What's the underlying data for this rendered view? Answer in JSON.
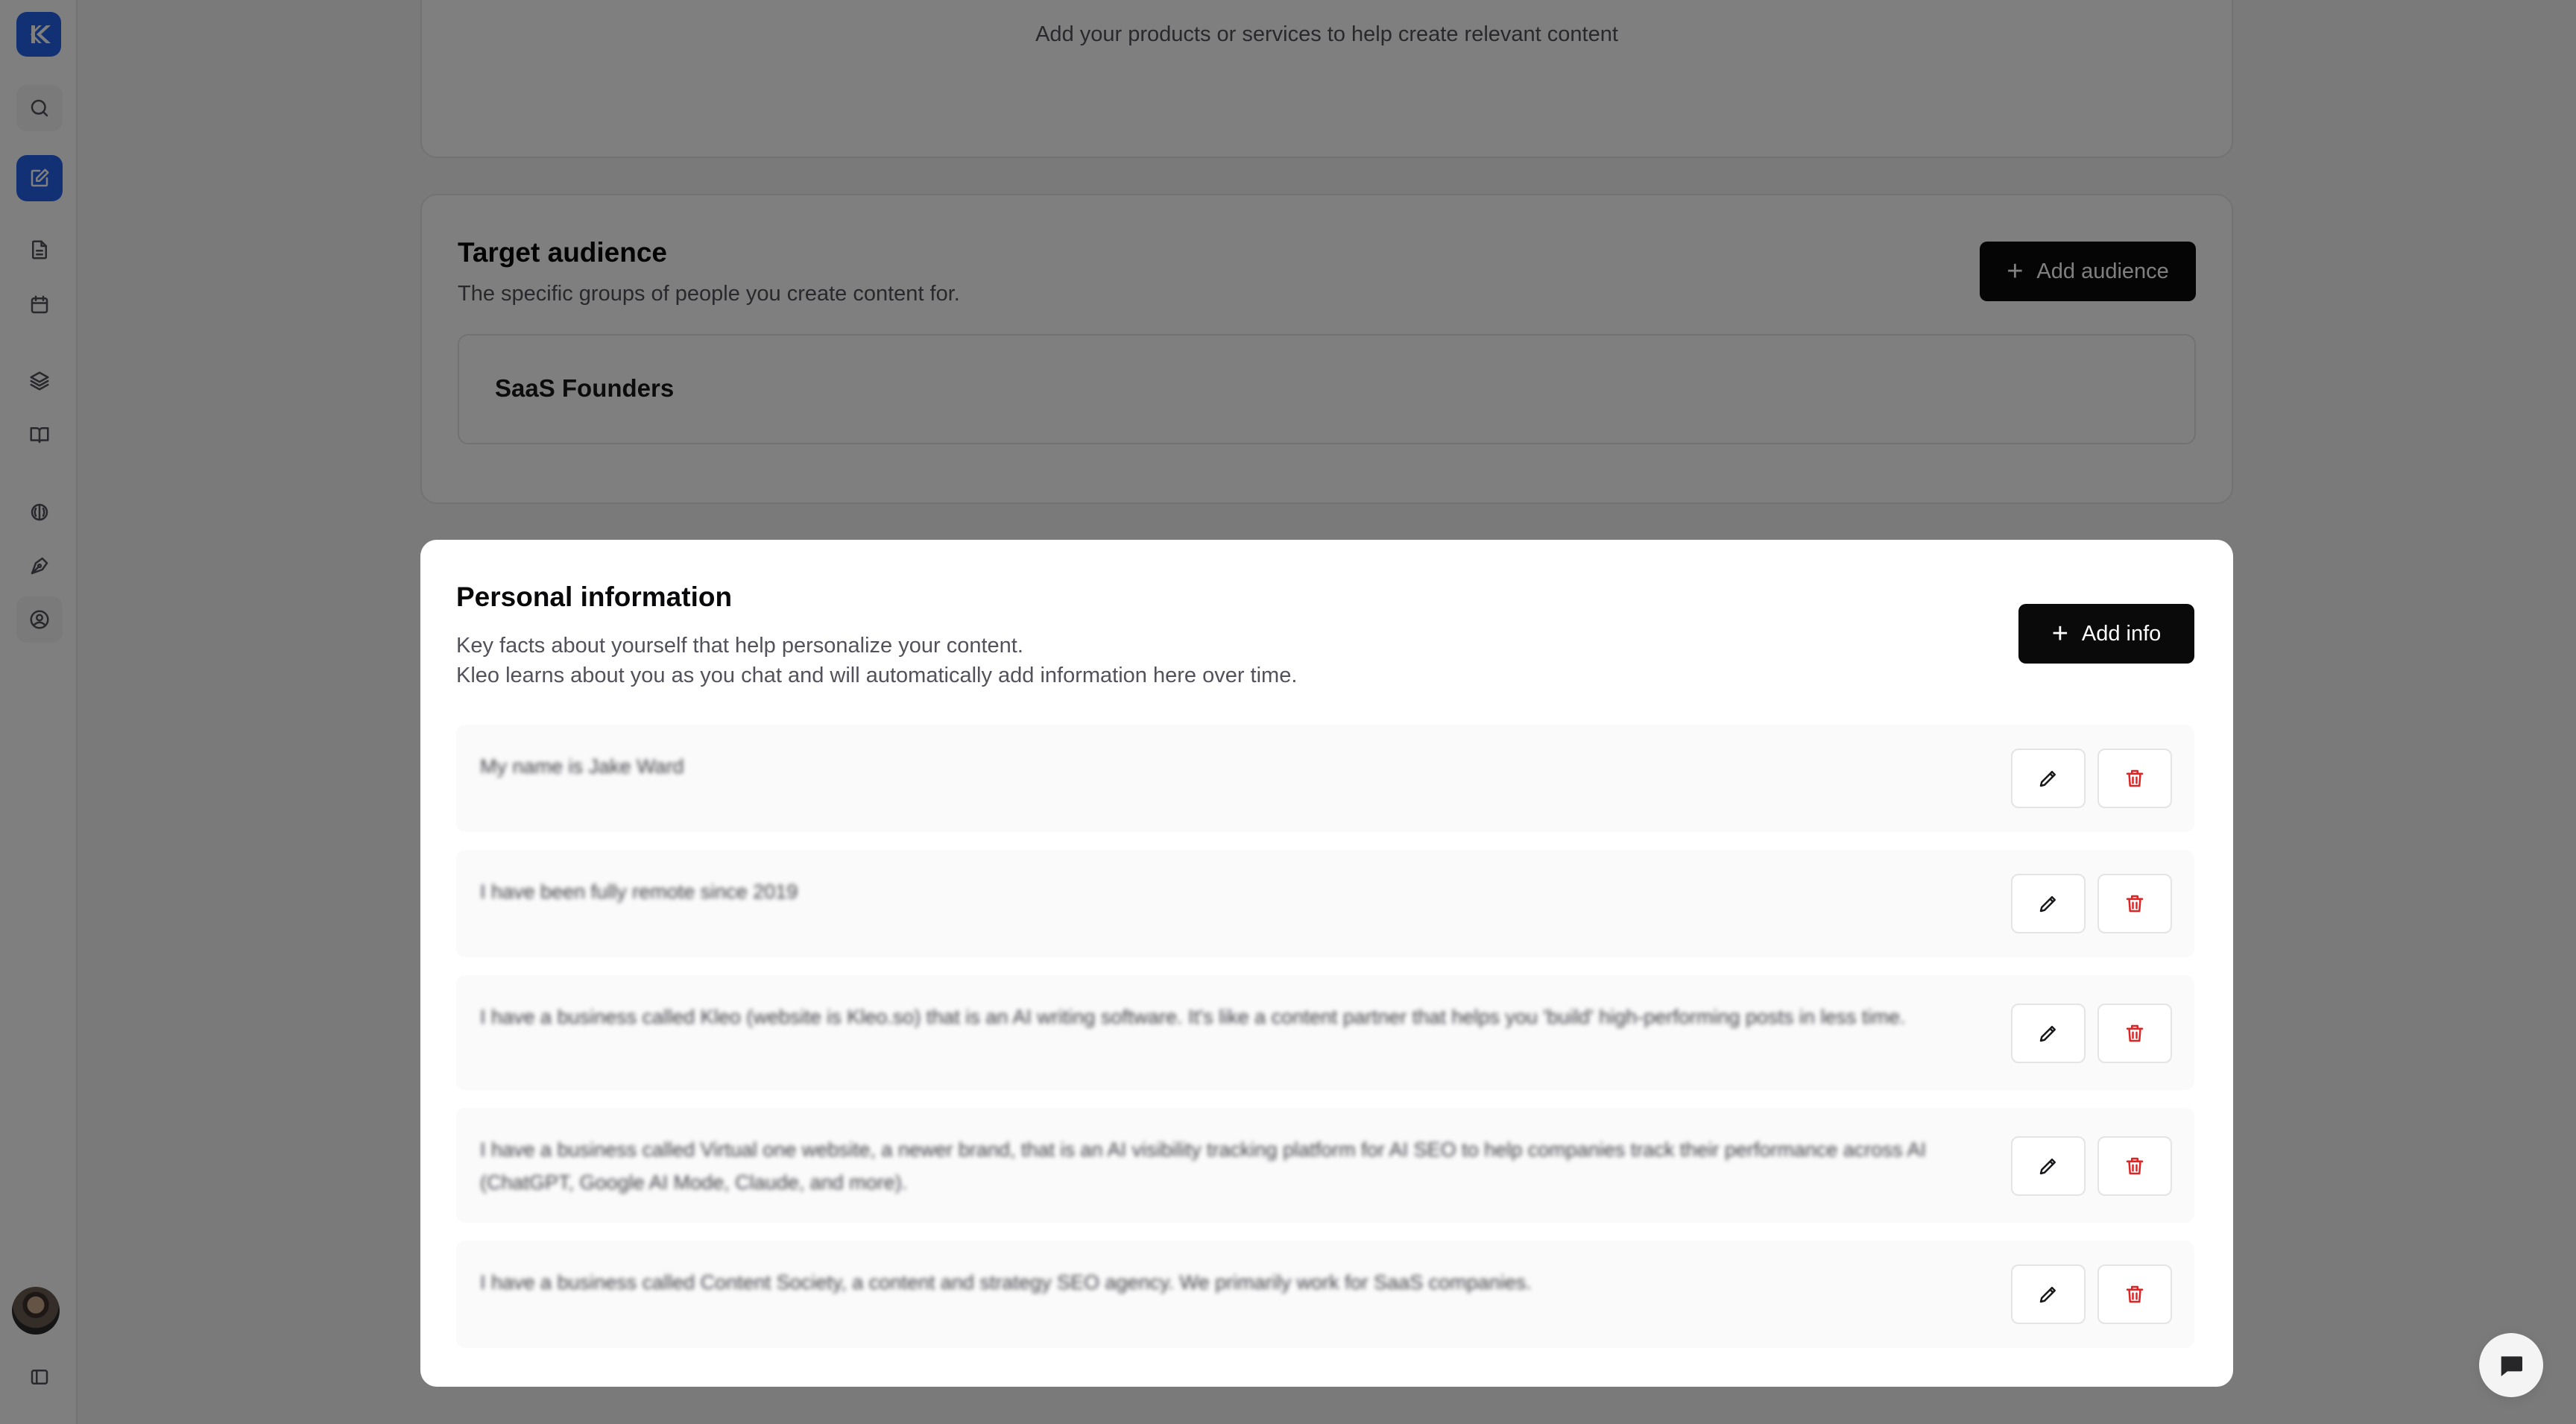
{
  "sidebar": {
    "items": [
      {
        "name": "logo",
        "icon": "kleo-logo-icon"
      },
      {
        "name": "search",
        "icon": "search-icon"
      },
      {
        "name": "compose",
        "icon": "compose-icon",
        "active": true
      },
      {
        "name": "documents",
        "icon": "document-icon"
      },
      {
        "name": "calendar",
        "icon": "calendar-icon"
      },
      {
        "name": "layers",
        "icon": "layers-icon"
      },
      {
        "name": "library",
        "icon": "book-icon"
      },
      {
        "name": "brain",
        "icon": "brain-icon"
      },
      {
        "name": "style",
        "icon": "pen-tool-icon"
      },
      {
        "name": "profile",
        "icon": "user-circle-icon",
        "selected": true
      }
    ],
    "bottom": {
      "avatar": "user-avatar",
      "toggle_icon": "sidebar-toggle-icon"
    }
  },
  "products": {
    "hint": "Add your products or services to help create relevant content"
  },
  "audience": {
    "title": "Target audience",
    "description": "The specific groups of people you create content for.",
    "add_button": "Add audience",
    "items": [
      "SaaS Founders"
    ]
  },
  "personal_info": {
    "title": "Personal information",
    "description_line1": "Key facts about yourself that help personalize your content.",
    "description_line2": "Kleo learns about you as you chat and will automatically add information here over time.",
    "add_button": "Add info",
    "entries": [
      {
        "text": "My name is Jake Ward"
      },
      {
        "text": "I have been fully remote since 2019"
      },
      {
        "text": "I have a business called Kleo (website is Kleo.so) that is an AI writing software. It's like a content partner that helps you 'build' high-performing posts in less time."
      },
      {
        "text": "I have a business called Virtual one website, a newer brand, that is an AI visibility tracking platform for AI SEO to help companies track their performance across AI (ChatGPT, Google AI Mode, Claude, and more)."
      },
      {
        "text": "I have a business called Content Society, a content and strategy SEO agency. We primarily work for SaaS companies."
      }
    ]
  },
  "colors": {
    "accent": "#2563eb",
    "danger": "#dc2626",
    "button_dark": "#0a0a0a"
  }
}
